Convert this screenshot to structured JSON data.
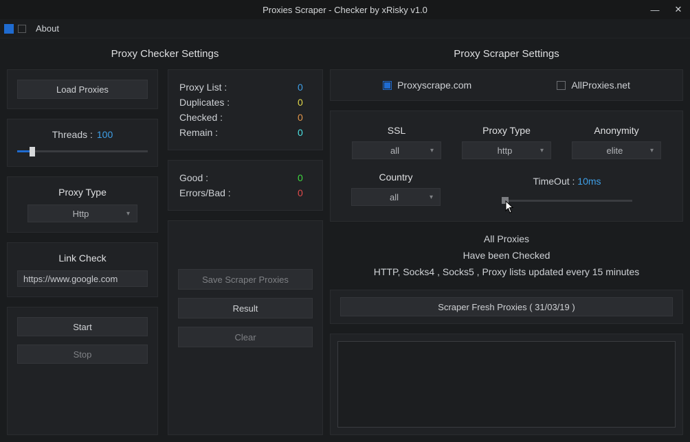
{
  "window": {
    "title": "Proxies Scraper - Checker by xRisky v1.0",
    "minimize": "—",
    "close": "✕"
  },
  "menu": {
    "about": "About"
  },
  "left": {
    "title": "Proxy Checker Settings",
    "load_proxies": "Load Proxies",
    "threads_label": "Threads :",
    "threads_value": "100",
    "proxy_type_label": "Proxy Type",
    "proxy_type_value": "Http",
    "link_check_label": "Link Check",
    "link_check_value": "https://www.google.com",
    "start": "Start",
    "stop": "Stop",
    "stats": {
      "proxy_list_k": "Proxy List :",
      "proxy_list_v": "0",
      "duplicates_k": "Duplicates :",
      "duplicates_v": "0",
      "checked_k": "Checked :",
      "checked_v": "0",
      "remain_k": "Remain :",
      "remain_v": "0",
      "good_k": "Good :",
      "good_v": "0",
      "bad_k": "Errors/Bad :",
      "bad_v": "0"
    },
    "save_scraper": "Save Scraper Proxies",
    "result": "Result",
    "clear": "Clear"
  },
  "right": {
    "title": "Proxy Scraper Settings",
    "src1": "Proxyscrape.com",
    "src2": "AllProxies.net",
    "ssl_label": "SSL",
    "ssl_value": "all",
    "ptype_label": "Proxy Type",
    "ptype_value": "http",
    "anon_label": "Anonymity",
    "anon_value": "elite",
    "country_label": "Country",
    "country_value": "all",
    "timeout_label": "TimeOut :",
    "timeout_value": "10ms",
    "info1": "All Proxies",
    "info2": "Have been Checked",
    "info3": "HTTP, Socks4 , Socks5  , Proxy lists updated every 15 minutes",
    "scrape_btn": "Scraper Fresh Proxies ( 31/03/19 )"
  }
}
